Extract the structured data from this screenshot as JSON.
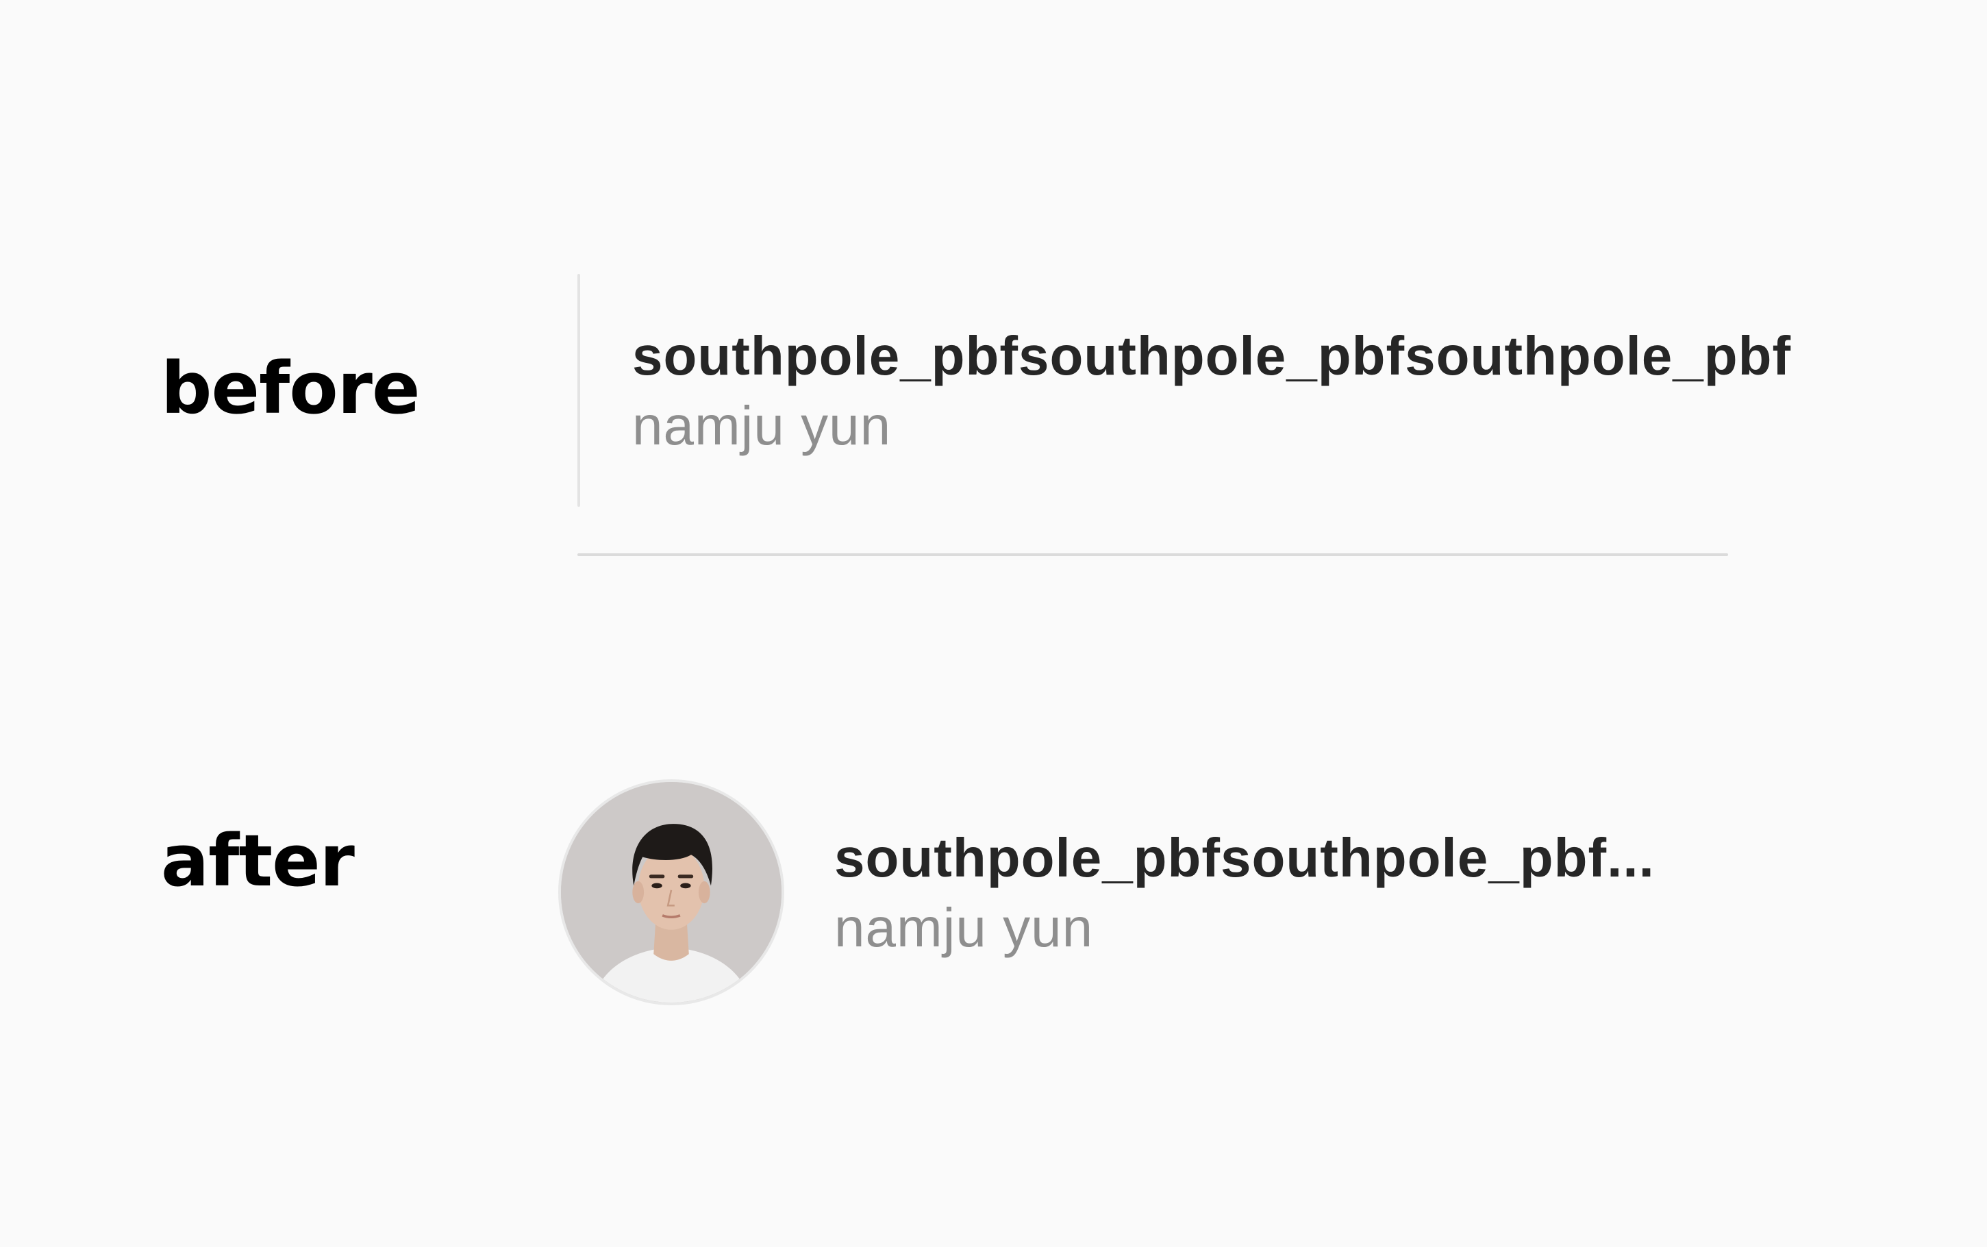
{
  "labels": {
    "before": "before",
    "after": "after"
  },
  "before_row": {
    "username": "southpole_pbfsouthpole_pbfsouthpole_pbf",
    "full_name": "namju yun"
  },
  "after_row": {
    "username": "southpole_pbfsouthpole_pbf",
    "full_name": "namju yun",
    "avatar_icon": "profile-photo"
  },
  "colors": {
    "background": "#fafafa",
    "label_text": "#000000",
    "username_text": "#262626",
    "fullname_text": "#8e8e8e",
    "divider": "#dbdbdb"
  }
}
